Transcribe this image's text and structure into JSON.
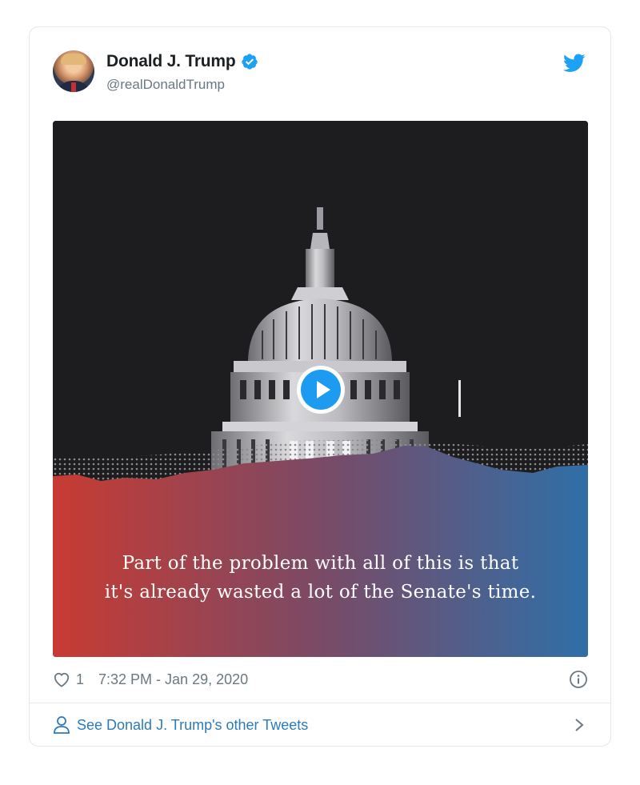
{
  "tweet": {
    "author_name": "Donald J. Trump",
    "author_handle": "@realDonaldTrump",
    "verified": true,
    "media_caption_line1": "Part of the problem with all of this is that",
    "media_caption_line2": "it's already wasted a lot of the Senate's time.",
    "like_count": "1",
    "timestamp": "7:32 PM - Jan 29, 2020"
  },
  "footer": {
    "label": "See Donald J. Trump's other Tweets"
  },
  "colors": {
    "accent": "#1da1f2",
    "link": "#2b7bb9",
    "muted": "#697882",
    "gradient_left": "#c83b32",
    "gradient_right": "#2f6fa8"
  },
  "icons": {
    "brand": "twitter-bird-icon",
    "verified": "verified-badge-icon",
    "like": "heart-icon",
    "info": "info-icon",
    "profile": "person-icon",
    "next": "chevron-right-icon",
    "media": "play-icon"
  }
}
